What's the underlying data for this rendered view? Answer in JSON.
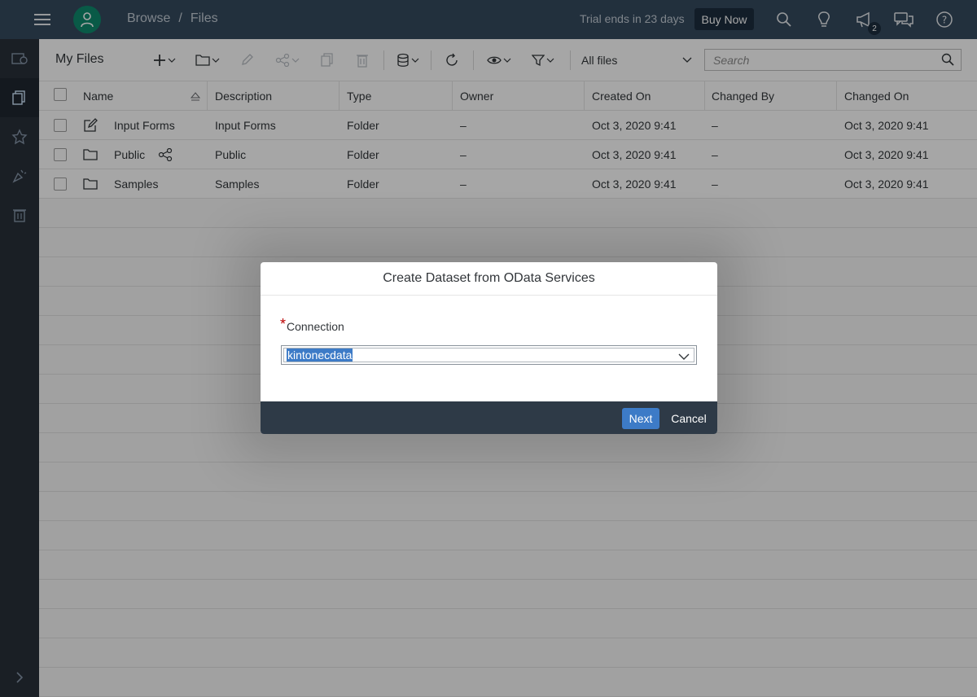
{
  "shell": {
    "breadcrumb_root": "Browse",
    "breadcrumb_separator": "/",
    "breadcrumb_current": "Files",
    "trial_text": "Trial ends in 23 days",
    "buy_now": "Buy Now",
    "notification_count": "2",
    "icons": [
      "menu-icon",
      "user-icon",
      "search-icon",
      "lightbulb-icon",
      "megaphone-icon",
      "discussion-icon",
      "help-icon"
    ]
  },
  "sidenav": {
    "items": [
      "home-icon",
      "files-icon",
      "favorites-icon",
      "featured-icon",
      "trash-icon"
    ],
    "active_index": 1,
    "expand_icon": "chevron-right-icon"
  },
  "toolbar": {
    "title": "My Files",
    "filter_label": "All files",
    "search_placeholder": "Search"
  },
  "table": {
    "columns": [
      "Name",
      "Description",
      "Type",
      "Owner",
      "Created On",
      "Changed By",
      "Changed On"
    ],
    "rows": [
      {
        "name": "Input Forms",
        "description": "Input Forms",
        "type": "Folder",
        "owner": "–",
        "created_on": "Oct 3, 2020 9:41",
        "changed_by": "–",
        "changed_on": "Oct 3, 2020 9:41",
        "icon": "edit-icon"
      },
      {
        "name": "Public",
        "description": "Public",
        "type": "Folder",
        "owner": "–",
        "created_on": "Oct 3, 2020 9:41",
        "changed_by": "–",
        "changed_on": "Oct 3, 2020 9:41",
        "icon": "folder-icon",
        "shared": true
      },
      {
        "name": "Samples",
        "description": "Samples",
        "type": "Folder",
        "owner": "–",
        "created_on": "Oct 3, 2020 9:41",
        "changed_by": "–",
        "changed_on": "Oct 3, 2020 9:41",
        "icon": "folder-icon"
      }
    ]
  },
  "dialog": {
    "title": "Create Dataset from OData Services",
    "required_marker": "*",
    "connection_label": "Connection",
    "connection_value": "kintonecdata",
    "next_label": "Next",
    "cancel_label": "Cancel"
  },
  "colors": {
    "shell_bg": "#354a5f",
    "sidenav_bg": "#29313a",
    "accent": "#3d7bc7",
    "dialog_footer": "#2e3a47",
    "required": "#bb0000"
  }
}
